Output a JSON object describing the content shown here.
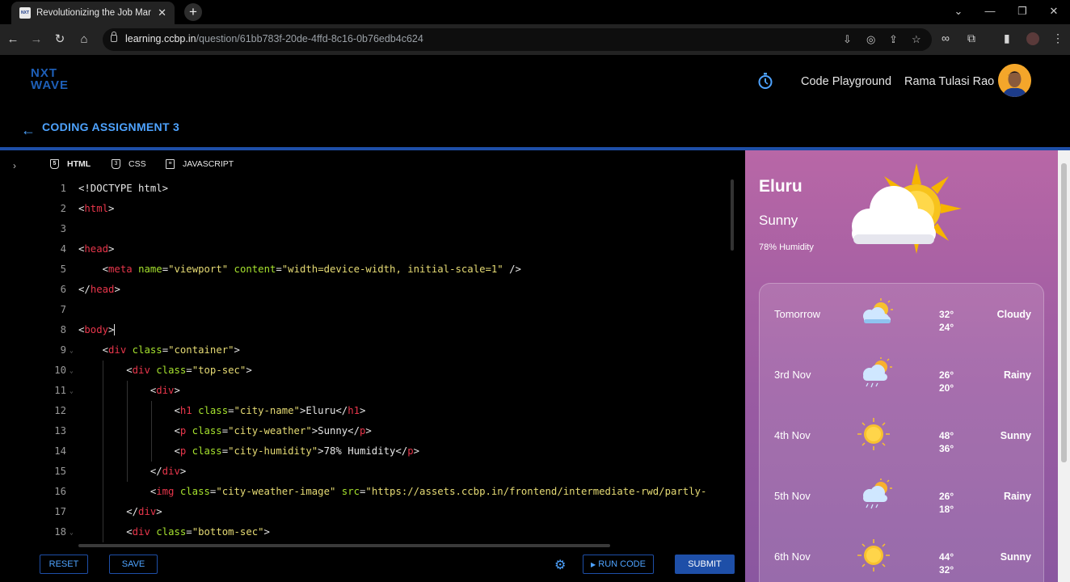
{
  "browser": {
    "tab_title": "Revolutionizing the Job Market",
    "url_domain": "learning.ccbp.in",
    "url_path": "/question/61bb783f-20de-4ffd-8c16-0b76edb4c624"
  },
  "header": {
    "logo_line1": "NXT",
    "logo_line2": "WAVE",
    "code_playground": "Code Playground",
    "user_name": "Rama Tulasi Rao",
    "back_title": "CODING ASSIGNMENT 3"
  },
  "editor": {
    "tabs": [
      "HTML",
      "CSS",
      "JAVASCRIPT"
    ],
    "line_numbers": [
      "1",
      "2",
      "3",
      "4",
      "5",
      "6",
      "7",
      "8",
      "9",
      "10",
      "11",
      "12",
      "13",
      "14",
      "15",
      "16",
      "17",
      "18"
    ],
    "buttons": {
      "reset": "RESET",
      "save": "SAVE",
      "run": "RUN CODE",
      "submit": "SUBMIT"
    }
  },
  "preview": {
    "city": "Eluru",
    "weather": "Sunny",
    "humidity": "78% Humidity",
    "forecast": [
      {
        "day": "Tomorrow",
        "hi": "32°",
        "lo": "24°",
        "cond": "Cloudy",
        "icon": "partly-cloudy-icon"
      },
      {
        "day": "3rd Nov",
        "hi": "26°",
        "lo": "20°",
        "cond": "Rainy",
        "icon": "rain-icon"
      },
      {
        "day": "4th Nov",
        "hi": "48°",
        "lo": "36°",
        "cond": "Sunny",
        "icon": "sun-icon"
      },
      {
        "day": "5th Nov",
        "hi": "26°",
        "lo": "18°",
        "cond": "Rainy",
        "icon": "rain-icon"
      },
      {
        "day": "6th Nov",
        "hi": "44°",
        "lo": "32°",
        "cond": "Sunny",
        "icon": "sun-icon"
      }
    ]
  },
  "colors": {
    "accent": "#4ea3ff",
    "brand_blue": "#1e4fa8",
    "tag": "#e8364b",
    "attr": "#a6e22e",
    "string": "#e6db74"
  }
}
